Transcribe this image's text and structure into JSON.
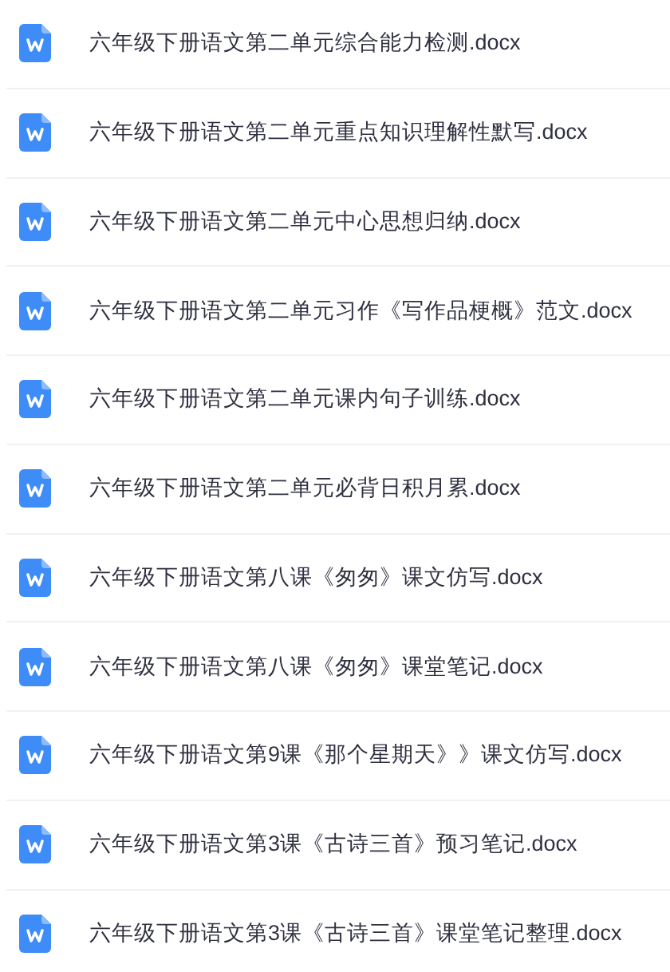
{
  "files": [
    {
      "name": "六年级下册语文第二单元综合能力检测.docx"
    },
    {
      "name": "六年级下册语文第二单元重点知识理解性默写.docx"
    },
    {
      "name": "六年级下册语文第二单元中心思想归纳.docx"
    },
    {
      "name": "六年级下册语文第二单元习作《写作品梗概》范文.docx"
    },
    {
      "name": "六年级下册语文第二单元课内句子训练.docx"
    },
    {
      "name": "六年级下册语文第二单元必背日积月累.docx"
    },
    {
      "name": "六年级下册语文第八课《匆匆》课文仿写.docx"
    },
    {
      "name": "六年级下册语文第八课《匆匆》课堂笔记.docx"
    },
    {
      "name": "六年级下册语文第9课《那个星期天》》课文仿写.docx"
    },
    {
      "name": "六年级下册语文第3课《古诗三首》预习笔记.docx"
    },
    {
      "name": "六年级下册语文第3课《古诗三首》课堂笔记整理.docx"
    }
  ]
}
